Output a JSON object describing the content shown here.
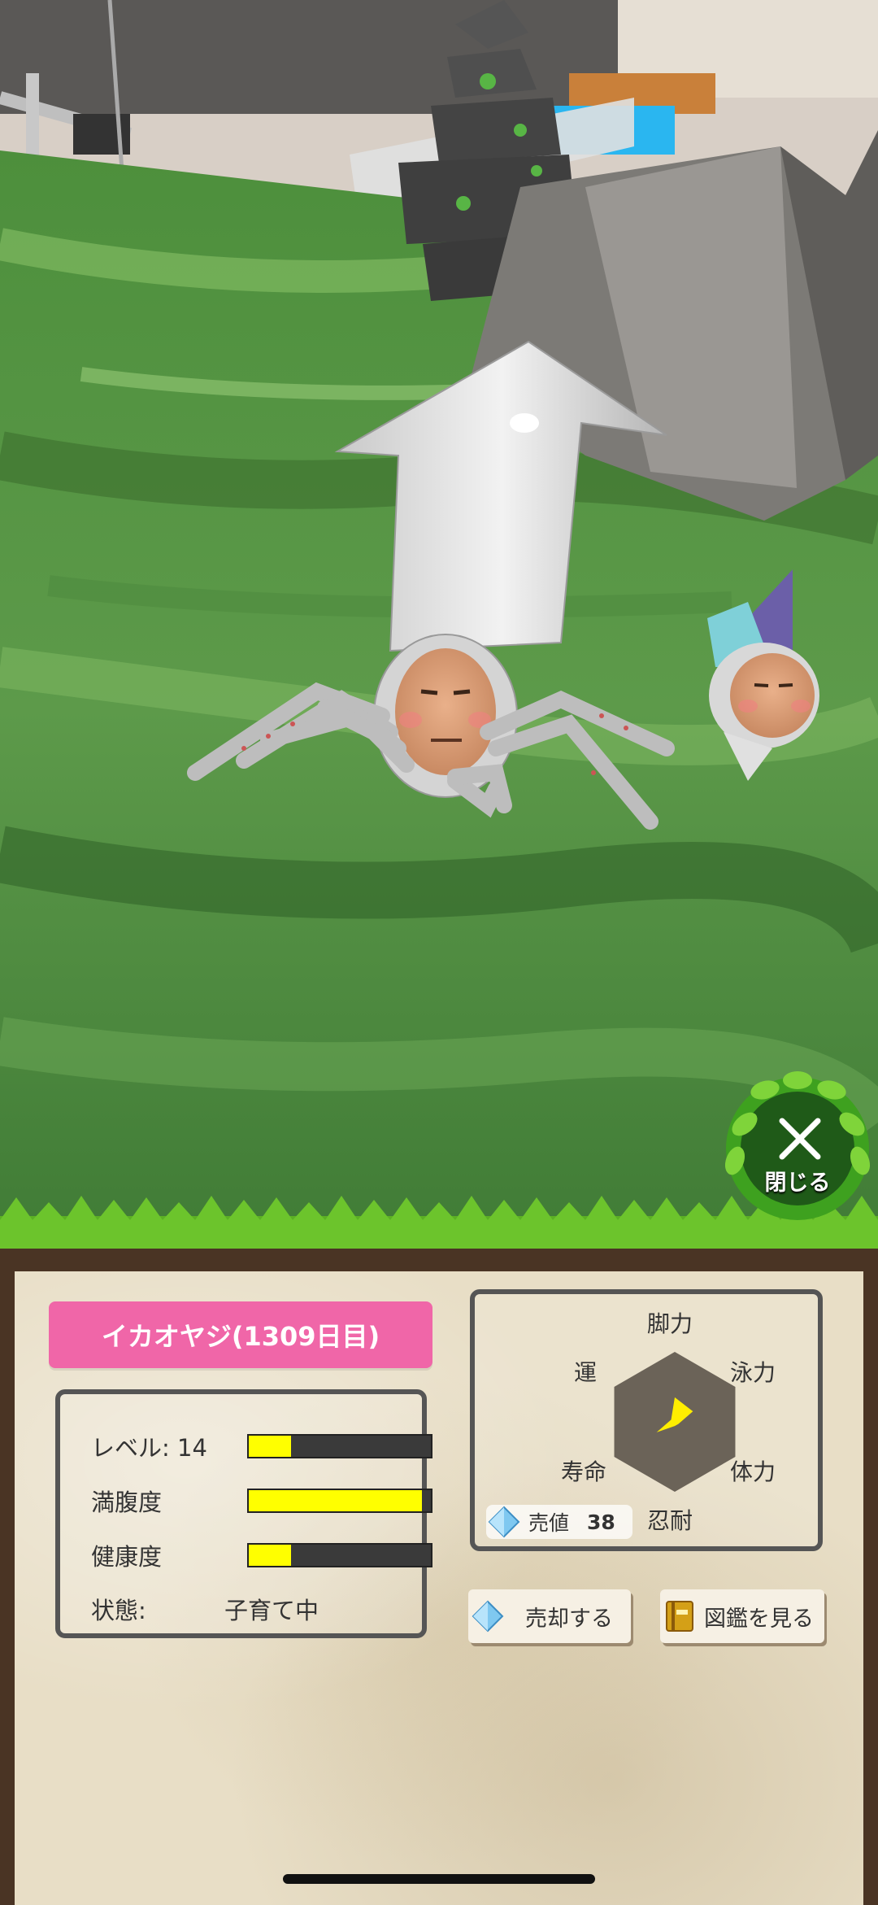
{
  "creature": {
    "name": "イカオヤジ(1309日目)"
  },
  "stats": {
    "level_label": "レベル: 14",
    "level_fraction": 0.23,
    "fullness_label": "満腹度",
    "fullness_fraction": 0.95,
    "health_label": "健康度",
    "health_fraction": 0.23,
    "status_label": "状態:",
    "status_value": "子育て中"
  },
  "radar": {
    "labels": {
      "top": "脚力",
      "top_right": "泳力",
      "bottom_right": "体力",
      "bottom": "忍耐",
      "bottom_left": "寿命",
      "top_left": "運"
    },
    "values": [
      0.35,
      0.3,
      0.0,
      0.0,
      0.3,
      0.0
    ],
    "hex_color": "#6b6358",
    "fill_color": "#ffee00"
  },
  "price": {
    "label": "売値",
    "value": "38",
    "icon": "diamond-icon"
  },
  "buttons": {
    "sell": "売却する",
    "sell_icon": "diamond-icon",
    "encyclopedia": "図鑑を見る",
    "encyclopedia_icon": "book-icon",
    "close": "閉じる",
    "close_icon": "close-icon"
  },
  "colors": {
    "name_banner": "#f066a8",
    "bar_fill": "#ffff00",
    "bar_bg": "#3a3a3a"
  }
}
